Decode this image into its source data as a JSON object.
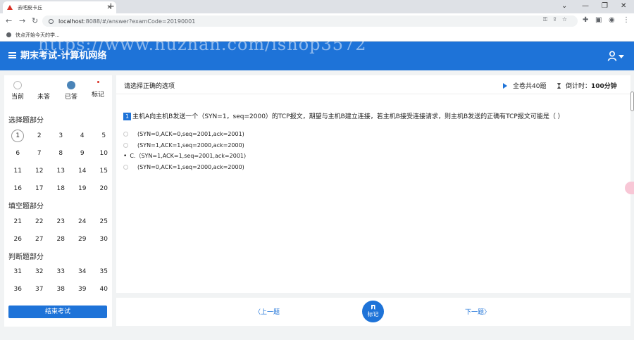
{
  "browser": {
    "tab_title": "去吧皮卡丘",
    "url_host": "localhost",
    "url_rest": ":8088/#/answer?examCode=20190001",
    "bookmark": "快点开始今天的学..."
  },
  "watermark": "https://www.huzhan.com/ishop3572",
  "header": {
    "title": "期末考试-计算机网络"
  },
  "legend": [
    {
      "label": "当前"
    },
    {
      "label": "未答"
    },
    {
      "label": "已答"
    },
    {
      "label": "标记"
    }
  ],
  "sections": [
    {
      "title": "选择题部分",
      "numbers": [
        "1",
        "2",
        "3",
        "4",
        "5",
        "6",
        "7",
        "8",
        "9",
        "10",
        "11",
        "12",
        "13",
        "14",
        "15",
        "16",
        "17",
        "18",
        "19",
        "20"
      ]
    },
    {
      "title": "填空题部分",
      "numbers": [
        "21",
        "22",
        "23",
        "24",
        "25",
        "26",
        "27",
        "28",
        "29",
        "30"
      ]
    },
    {
      "title": "判断题部分",
      "numbers": [
        "31",
        "32",
        "33",
        "34",
        "35",
        "36",
        "37",
        "38",
        "39",
        "40"
      ]
    }
  ],
  "end_exam_label": "结束考试",
  "main": {
    "instruction": "请选择正确的选项",
    "total": "全卷共40题",
    "timer_label": "倒计时：",
    "timer_value": "100分钟",
    "question_number": "1",
    "question_text": "主机A向主机B发送一个（SYN=1，seq=2000）的TCP报文，期望与主机B建立连接，若主机B接受连接请求，则主机B发送的正确有TCP报文可能是（ ）",
    "options": [
      {
        "text": "(SYN=0,ACK=0,seq=2001,ack=2001)"
      },
      {
        "text": "(SYN=1,ACK=1,seq=2000,ack=2000)"
      },
      {
        "text": "C.（SYN=1,ACK=1,seq=2001,ack=2001)",
        "marker": "•"
      },
      {
        "text": "(SYN=0,ACK=1,seq=2000,ack=2000)"
      }
    ]
  },
  "nav": {
    "prev": "上一题",
    "mark": "标记",
    "next": "下一题"
  },
  "colors": {
    "accent": "#1e73d8",
    "answered": "#4a84b8",
    "marked": "#d93025"
  }
}
